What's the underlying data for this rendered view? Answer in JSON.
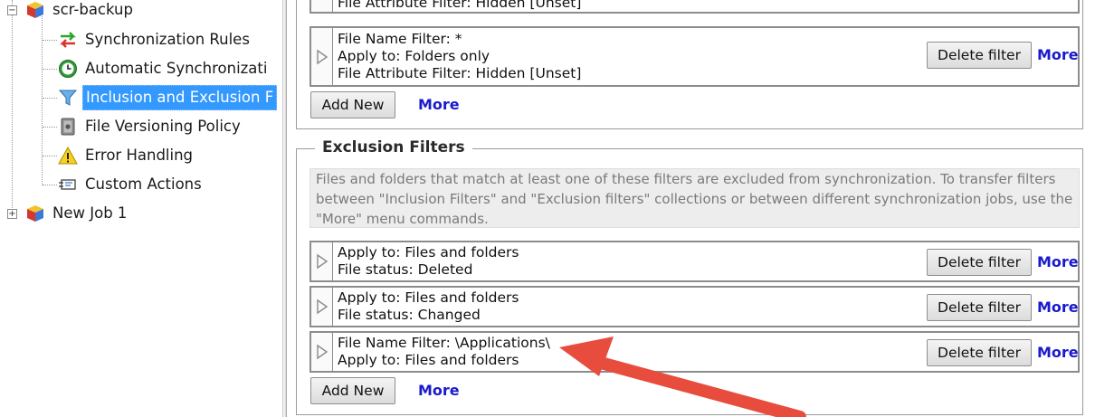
{
  "tree": {
    "root_item": "scr-backup",
    "children": [
      "Synchronization Rules",
      "Automatic Synchronizati",
      "Inclusion and Exclusion F",
      "File Versioning Policy",
      "Error Handling",
      "Custom Actions"
    ],
    "selected_index": 2,
    "second_root": "New Job 1"
  },
  "inclusion": {
    "partial_row_text": "File Attribute Filter: Hidden [Unset]",
    "row": {
      "lines": [
        "File Name Filter: *",
        "Apply to: Folders only",
        "File Attribute Filter: Hidden [Unset]"
      ],
      "delete_label": "Delete filter",
      "more_label": "More"
    },
    "add_new_label": "Add New",
    "more_label": "More"
  },
  "exclusion": {
    "title": "Exclusion Filters",
    "description": "Files and folders that match at least one of these filters are excluded from synchronization. To transfer filters between \"Inclusion Filters\" and \"Exclusion filters\" collections or between different synchronization jobs, use the \"More\" menu commands.",
    "rows": [
      {
        "line1": "Apply to: Files and folders",
        "line2": "File status: Deleted",
        "delete_label": "Delete filter",
        "more_label": "More"
      },
      {
        "line1": "Apply to: Files and folders",
        "line2": "File status: Changed",
        "delete_label": "Delete filter",
        "more_label": "More"
      },
      {
        "line1": "File Name Filter: \\Applications\\",
        "line2": "Apply to: Files and folders",
        "delete_label": "Delete filter",
        "more_label": "More"
      }
    ],
    "add_new_label": "Add New",
    "more_label": "More"
  },
  "annotation": {
    "arrow_color": "#e84c3d"
  }
}
